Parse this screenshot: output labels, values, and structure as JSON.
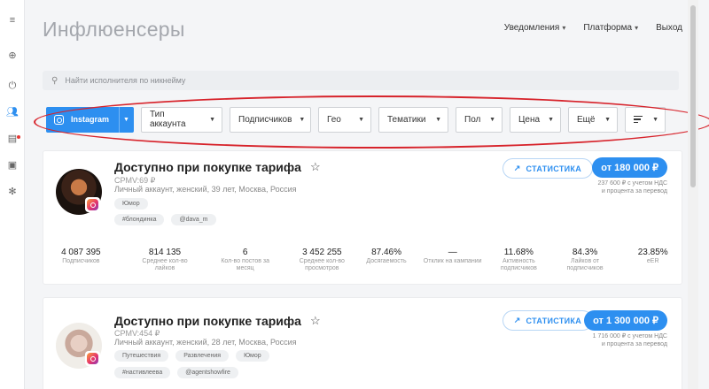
{
  "page": {
    "title": "Инфлюенсеры"
  },
  "nav": {
    "notifications": "Уведомления",
    "platform": "Платформа",
    "logout": "Выход"
  },
  "search": {
    "placeholder": "Найти исполнителя по никнейму"
  },
  "filters": {
    "platform": "Instagram",
    "account_type": "Тип аккаунта",
    "followers": "Подписчиков",
    "geo": "Гео",
    "topics": "Тематики",
    "gender": "Пол",
    "price": "Цена",
    "more": "Ещё"
  },
  "cards": [
    {
      "name": "Доступно при покупке тарифа",
      "cpmv": "CPMV:69 ₽",
      "description": "Личный аккаунт, женский, 39 лет, Москва, Россия",
      "tags_row1": [
        "Юмор"
      ],
      "tags_row2": [
        "#блондинка",
        "@dava_m"
      ],
      "stats_button": "СТАТИСТИКА",
      "price": "от 180 000 ₽",
      "price_note_1": "237 600 ₽ с учетом НДС",
      "price_note_2": "и процента за перевод",
      "stats": [
        {
          "value": "4 087 395",
          "label": "Подписчиков"
        },
        {
          "value": "814 135",
          "label": "Среднее кол-во лайков"
        },
        {
          "value": "6",
          "label": "Кол-во постов за месяц"
        },
        {
          "value": "3 452 255",
          "label": "Среднее кол-во просмотров"
        },
        {
          "value": "87.46%",
          "label": "Досягаемость"
        },
        {
          "value": "—",
          "label": "Отклик на кампании"
        },
        {
          "value": "11.68%",
          "label": "Активность подписчиков"
        },
        {
          "value": "84.3%",
          "label": "Лайков от подписчиков"
        },
        {
          "value": "23.85%",
          "label": "eER"
        }
      ]
    },
    {
      "name": "Доступно при покупке тарифа",
      "cpmv": "CPMV:454 ₽",
      "description": "Личный аккаунт, женский, 28 лет, Москва, Россия",
      "tags_row1": [
        "Путешествия",
        "Развлечения",
        "Юмор"
      ],
      "tags_row2": [
        "#настивлеева",
        "@agentshowfire"
      ],
      "stats_button": "СТАТИСТИКА",
      "price": "от 1 300 000 ₽",
      "price_note_1": "1 716 000 ₽ с учетом НДС",
      "price_note_2": "и процента за перевод"
    }
  ]
}
